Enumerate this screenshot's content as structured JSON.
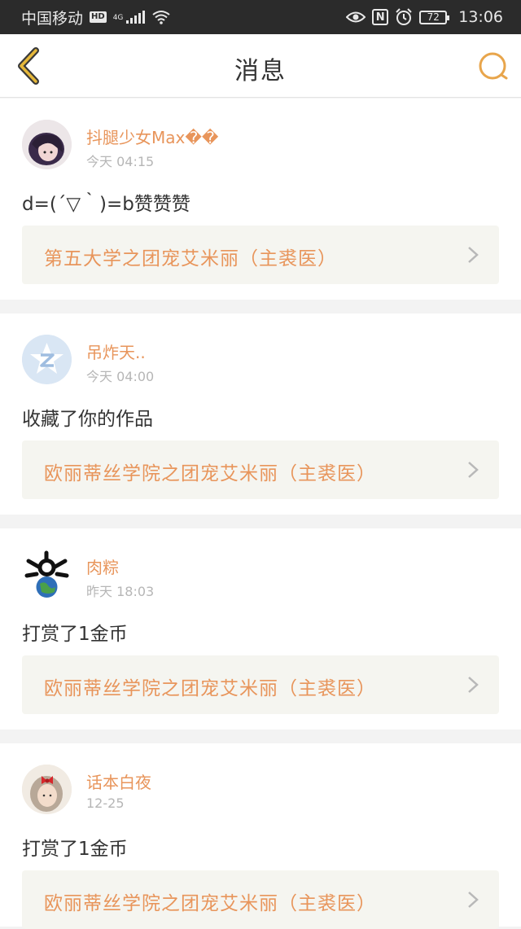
{
  "status_bar": {
    "carrier": "中国移动",
    "hd": "HD",
    "network": "4G",
    "battery": "72",
    "time": "13:06"
  },
  "header": {
    "title": "消息",
    "accent_color": "#e8a54b"
  },
  "messages": [
    {
      "user": "抖腿少女Max��",
      "time": "今天 04:15",
      "text": "d=(´▽｀)=b赞赞赞",
      "work_title": "第五大学之团宠艾米丽（主裘医）",
      "avatar_icon": "user-avatar-photo"
    },
    {
      "user": "吊炸天..",
      "time": "今天 04:00",
      "text": "收藏了你的作品",
      "work_title": "欧丽蒂丝学院之团宠艾米丽（主裘医）",
      "avatar_icon": "default-qzone-avatar"
    },
    {
      "user": "肉粽",
      "time": "昨天 18:03",
      "text": "打赏了1金币",
      "work_title": "欧丽蒂丝学院之团宠艾米丽（主裘医）",
      "avatar_icon": "globe-cartoon-avatar"
    },
    {
      "user": "话本白夜",
      "time": "12-25",
      "text": "打赏了1金币",
      "work_title": "欧丽蒂丝学院之团宠艾米丽（主裘医）",
      "avatar_icon": "girl-with-bow-avatar"
    }
  ]
}
